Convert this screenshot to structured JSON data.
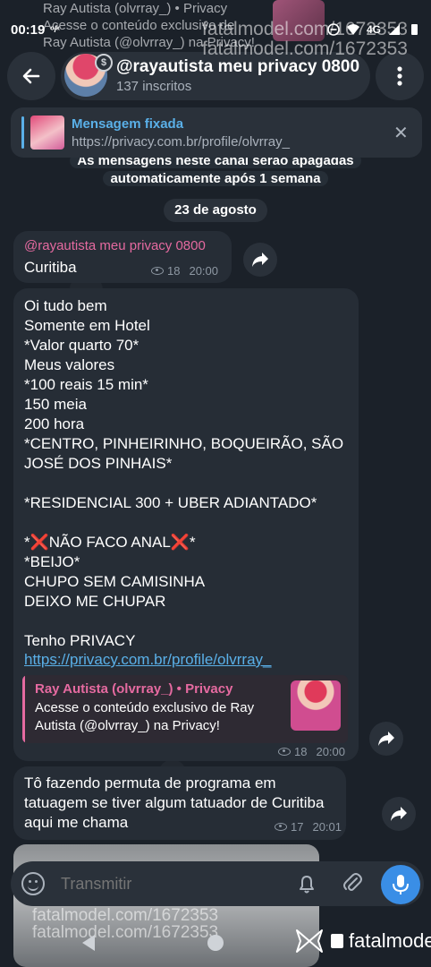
{
  "status_bar": {
    "time": "00:19",
    "network": "4G",
    "indicator": "ᵒ/ᵏ"
  },
  "notification_ghost": {
    "line1": "Ray Autista (olvrray_) • Privacy",
    "line2": "Acesse o conteúdo exclusivo de",
    "line3": "Ray Autista (@olvrray_) na Privacy!"
  },
  "watermark": {
    "top_line1": "fatalmodel.com/1672353",
    "top_line2": "fatalmodel.com/1672353",
    "bottom_line1": "fatalmodel.com/1672353",
    "bottom_line2": "fatalmodel.com/1672353",
    "brand": "fatalmodel"
  },
  "header": {
    "back_icon": "arrow-left-icon",
    "title": "@rayautista meu privacy 0800",
    "subtitle": "137 inscritos",
    "menu_icon": "more-vert-icon"
  },
  "pinned": {
    "label": "Mensagem fixada",
    "text": "https://privacy.com.br/profile/olvrray_",
    "close_icon": "close-icon"
  },
  "service_message": {
    "line1": "As mensagens neste canal serão apagadas",
    "line2": "automaticamente após 1 semana"
  },
  "date_separator": "23 de agosto",
  "messages": [
    {
      "author": "@rayautista meu privacy 0800",
      "text": "Curitiba",
      "views": "18",
      "time": "20:00"
    },
    {
      "text": "Oi tudo bem\nSomente em Hotel\n*Valor quarto 70*\nMeus valores\n*100 reais 15 min*\n150 meia\n200 hora\n*CENTRO, PINHEIRINHO, BOQUEIRÃO, SÃO JOSÉ DOS PINHAIS*\n\n*RESIDENCIAL 300 + UBER ADIANTADO*\n\n*❌NÃO FACO ANAL❌*\n              *BEIJO*\nCHUPO SEM CAMISINHA\n    DEIXO ME CHUPAR\n\nTenho PRIVACY",
      "link": "https://privacy.com.br/profile/olvrray_",
      "preview": {
        "title": "Ray Autista (olvrray_) • Privacy",
        "description": "Acesse o conteúdo exclusivo de Ray Autista (@olvrray_) na Privacy!"
      },
      "views": "18",
      "time": "20:00"
    },
    {
      "text": "Tô fazendo permuta de programa em tatuagem se tiver algum tatuador de Curitiba aqui me chama",
      "views": "17",
      "time": "20:01"
    }
  ],
  "composer": {
    "placeholder": "Transmitir",
    "emoji_icon": "emoji-icon",
    "bell_icon": "bell-icon",
    "attach_icon": "paperclip-icon",
    "mic_icon": "microphone-icon"
  },
  "colors": {
    "accent": "#3a8ee6",
    "author": "#e56aa0",
    "link": "#5ab0e8",
    "bubble": "#262d36"
  }
}
